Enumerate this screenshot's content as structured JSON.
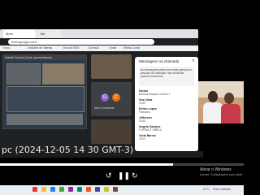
{
  "browser": {
    "tabs": [
      "Meet",
      "Tab"
    ],
    "address": "meet.google.com/",
    "bookmarks": [
      "Início",
      "Unidade de Tarefas",
      "Escola SESI",
      "Currículo",
      "Gmail",
      "Minha Conta"
    ]
  },
  "meet": {
    "share_label": "Gabriel Gomes (Você, apresentando)",
    "participant_label": "Meio Cuceanne",
    "avatar_letters": [
      "G",
      "C"
    ],
    "avatar_colors": [
      "#8e63ce",
      "#e8710a"
    ]
  },
  "chat": {
    "title": "Mensagens na chamada",
    "notice": "As mensagens podem ser vistas apenas por pessoas na chamada e são excluídas quando ela termina.",
    "messages": [
      {
        "name": "Karina",
        "text": "Bárbara Marques Gomes 1"
      },
      {
        "name": "Ana Clara",
        "text": "14:55"
      },
      {
        "name": "Kelvin Lopes",
        "text": "Palmares"
      },
      {
        "name": "Jefferson",
        "text": "14:55"
      },
      {
        "name": "Angela Campos",
        "text": "FLIPRAUT TABELA"
      },
      {
        "name": "Carla Barros",
        "text": "13:09"
      }
    ]
  },
  "video": {
    "overlay_text": "pc (2024-12-05 14 30 GMT-3)",
    "progress_percent": 71
  },
  "windows": {
    "activate_title": "Ativar o Windows",
    "activate_sub": "Acesse Configurações para ativar",
    "weather": "27°C",
    "weather_desc": "Pred. nublado"
  },
  "colors": {
    "taskbar_icons": [
      "#e53935",
      "#fbc02d",
      "#1e88e5",
      "#43a047",
      "#8e24aa",
      "#00897b",
      "#f4511e",
      "#3949ab",
      "#c0ca33",
      "#6d4c41"
    ]
  }
}
